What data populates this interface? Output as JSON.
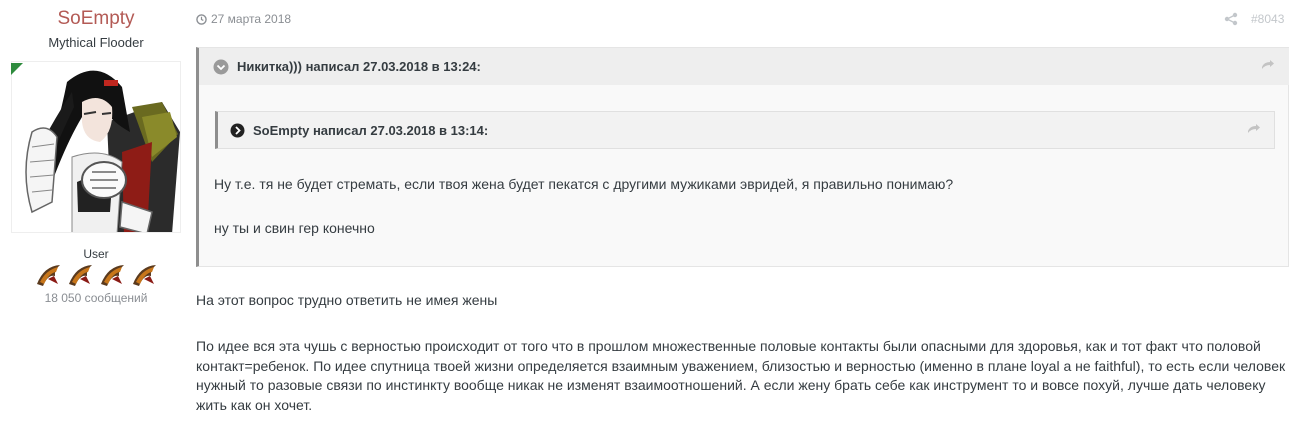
{
  "author": {
    "name": "SoEmpty",
    "title": "Mythical Flooder",
    "group": "User",
    "posts": "18 050 сообщений",
    "online": true,
    "avatar_icon": "anime-avatar-image",
    "rank_icon": "claw-rank-icon",
    "rank_pips": 4
  },
  "post": {
    "date": "27 марта 2018",
    "number": "#8043",
    "share_icon": "share-icon",
    "quote": {
      "citation": "Никитка))) написал 27.03.2018 в 13:24:",
      "nested": {
        "citation": "SoEmpty написал 27.03.2018 в 13:14:"
      },
      "lines": [
        "Ну т.е. тя не будет стремать, если твоя жена будет пекатся с другими мужиками эвридей, я правильно понимаю?",
        "ну ты и свин гер конечно"
      ]
    },
    "paragraphs": [
      "На этот вопрос трудно ответить не имея жены",
      "По идее вся эта чушь с верностью происходит от того что в прошлом множественные половые контакты были опасными для здоровья, как и тот факт что половой контакт=ребенок. По идее спутница твоей жизни определяется взаимным уважением, близостью и верностью (именно в плане loyal а не faithful), то есть если человек нужный то разовые связи по инстинкту вообще никак не изменят взаимоотношений. А если жену брать себе как инструмент то и вовсе похуй, лучше дать человеку жить как он хочет."
    ]
  },
  "colors": {
    "author_name": "#b35a55",
    "online_marker": "#2e8b3d",
    "quote_border": "#8e8e8e",
    "muted_text": "#8a8e93"
  }
}
